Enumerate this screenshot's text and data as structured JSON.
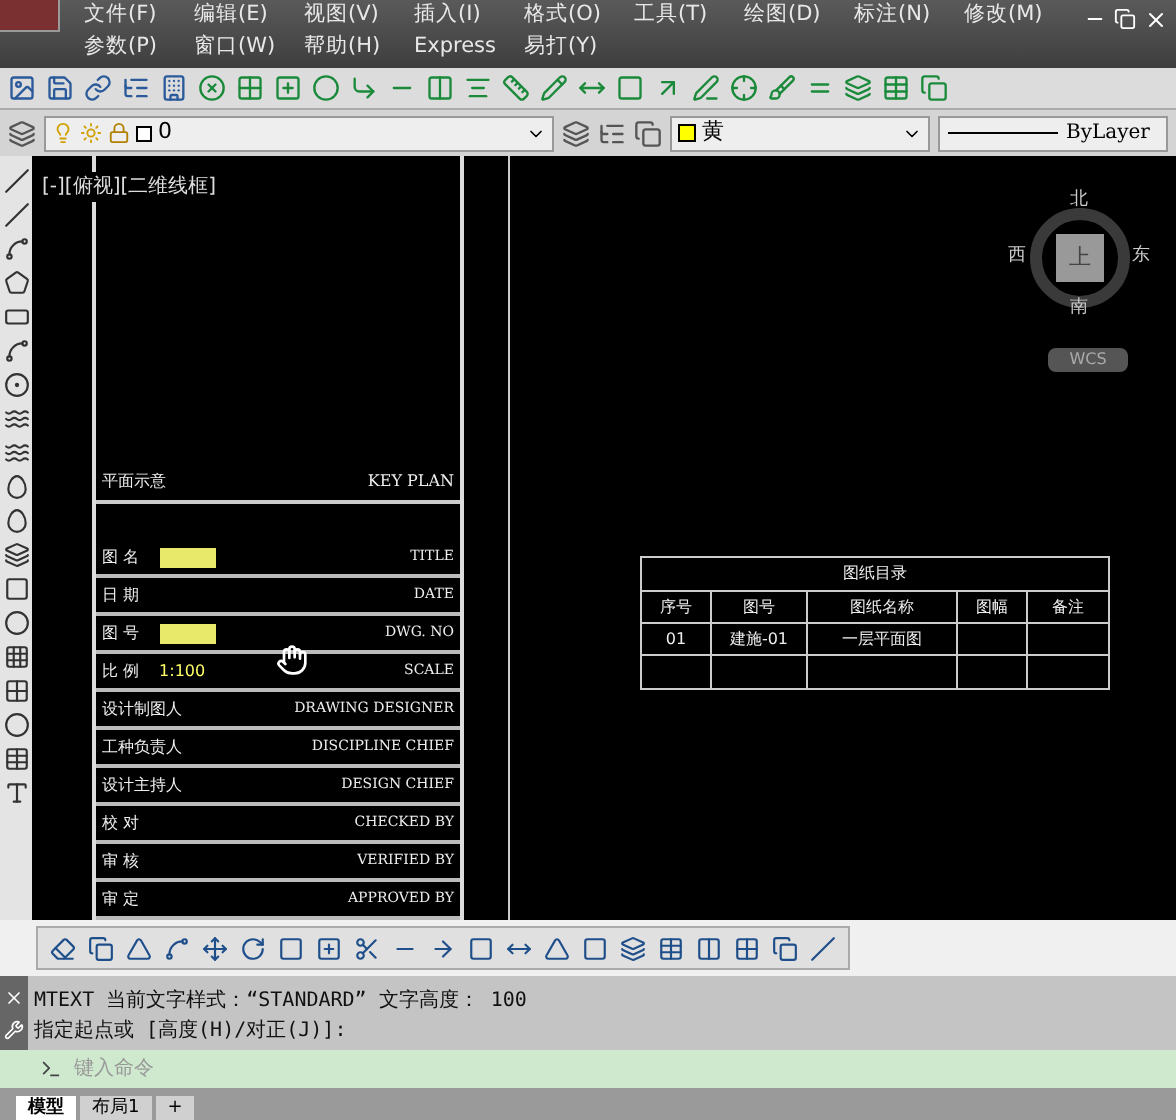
{
  "menu_rows": [
    [
      "文件(F)",
      "编辑(E)",
      "视图(V)",
      "插入(I)",
      "格式(O)",
      "工具(T)",
      "绘图(D)",
      "标注(N)",
      "修改(M)"
    ],
    [
      "参数(P)",
      "窗口(W)",
      "帮助(H)",
      "Express",
      "易打(Y)"
    ]
  ],
  "layer_bar": {
    "layer": "0",
    "color_name": "黄",
    "color": "#ffff00",
    "linetype": "ByLayer"
  },
  "viewport_label": "[-][俯视][二维线框]",
  "title_block": {
    "header": {
      "cn": "平面示意",
      "en": "KEY PLAN"
    },
    "rows": [
      {
        "cn": "图 名",
        "en": "TITLE",
        "kind": "highlight"
      },
      {
        "cn": "日 期",
        "en": "DATE",
        "kind": "plain"
      },
      {
        "cn": "图 号",
        "en": "DWG. NO",
        "kind": "highlight"
      },
      {
        "cn": "比 例",
        "en": "SCALE",
        "kind": "value",
        "value": "1:100"
      },
      {
        "cn": "设计制图人",
        "en": "DRAWING DESIGNER",
        "kind": "plain"
      },
      {
        "cn": "工种负责人",
        "en": "DISCIPLINE CHIEF",
        "kind": "plain"
      },
      {
        "cn": "设计主持人",
        "en": "DESIGN CHIEF",
        "kind": "plain"
      },
      {
        "cn": "校 对",
        "en": "CHECKED BY",
        "kind": "plain"
      },
      {
        "cn": "审 核",
        "en": "VERIFIED BY",
        "kind": "plain"
      },
      {
        "cn": "审 定",
        "en": "APPROVED BY",
        "kind": "plain"
      }
    ]
  },
  "drawing_table": {
    "title": "图纸目录",
    "columns": [
      "序号",
      "图号",
      "图纸名称",
      "图幅",
      "备注"
    ],
    "rows": [
      [
        "01",
        "建施-01",
        "一层平面图",
        "",
        ""
      ],
      [
        "",
        "",
        "",
        "",
        ""
      ]
    ]
  },
  "view_cube": {
    "north": "北",
    "south": "南",
    "east": "东",
    "west": "西",
    "face": "上",
    "ucs": "WCS"
  },
  "command": {
    "lines": [
      "MTEXT 当前文字样式：“STANDARD” 文字高度： 100",
      "指定起点或 [高度(H)/对正(J)]:"
    ],
    "placeholder": "键入命令"
  },
  "tabs": [
    {
      "label": "模型",
      "selected": true
    },
    {
      "label": "布局1",
      "selected": false
    },
    {
      "label": "+",
      "selected": false
    }
  ]
}
